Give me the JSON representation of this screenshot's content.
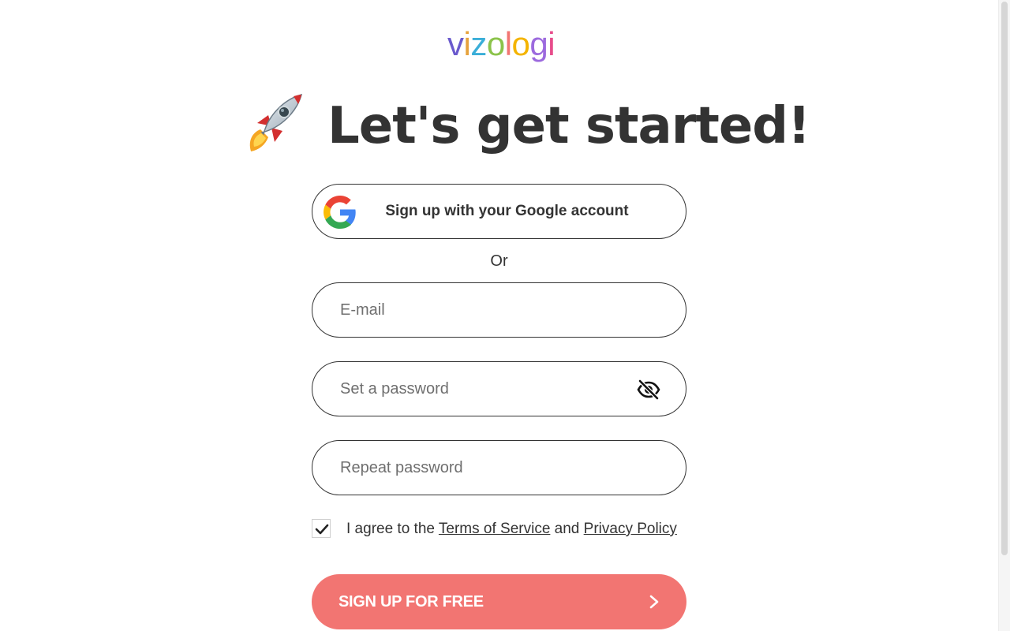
{
  "logo": {
    "letters": [
      "v",
      "i",
      "z",
      "o",
      "l",
      "o",
      "g",
      "i"
    ],
    "colors": [
      "#6a5acd",
      "#e6a23c",
      "#3aaed8",
      "#8bc34a",
      "#f27572",
      "#f4b400",
      "#9c6ade",
      "#e74c8b"
    ]
  },
  "heading": {
    "icon": "rocket-icon",
    "title": "Let's get started!"
  },
  "google": {
    "icon": "google-icon",
    "label": "Sign up with your Google account"
  },
  "divider": {
    "text": "Or"
  },
  "form": {
    "email": {
      "placeholder": "E-mail",
      "value": ""
    },
    "password": {
      "placeholder": "Set a password",
      "value": "",
      "toggle_icon": "eye-slash-icon"
    },
    "repeat": {
      "placeholder": "Repeat password",
      "value": ""
    }
  },
  "terms": {
    "checked": true,
    "prefix": "I agree to the ",
    "tos_link": "Terms of Service",
    "middle": " and ",
    "privacy_link": "Privacy Policy"
  },
  "submit": {
    "label": "SIGN UP FOR FREE",
    "icon": "chevron-right-icon",
    "color": "#f27572"
  }
}
